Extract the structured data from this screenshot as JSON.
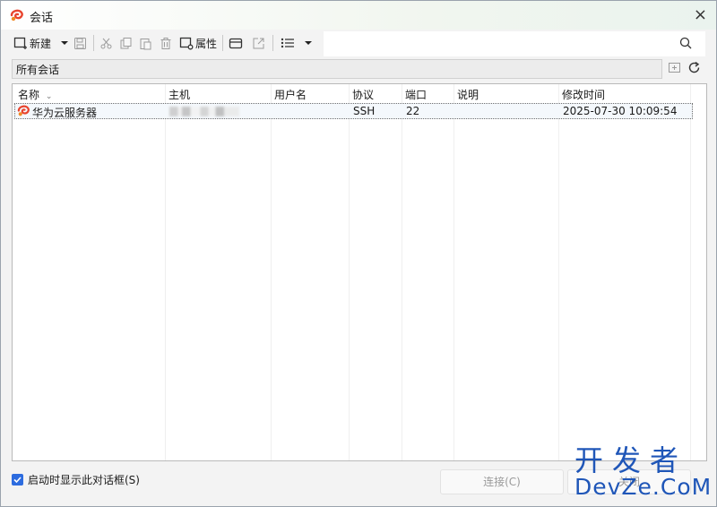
{
  "window": {
    "title": "会话",
    "close_glyph": "×"
  },
  "toolbar": {
    "new_label": "新建",
    "props_label": "属性",
    "icons": [
      "new-session-icon",
      "dropdown-arrow-icon",
      "save-icon",
      "cut-icon",
      "copy-icon",
      "paste-icon",
      "delete-icon",
      "properties-icon",
      "folder-icon",
      "export-icon",
      "list-view-icon",
      "view-dropdown-icon"
    ]
  },
  "search": {
    "value": "",
    "placeholder": ""
  },
  "path": {
    "label": "所有会话"
  },
  "columns": {
    "name": "名称",
    "host": "主机",
    "user": "用户名",
    "protocol": "协议",
    "port": "端口",
    "desc": "说明",
    "modified": "修改时间"
  },
  "sessions": [
    {
      "name": "华为云服务器",
      "host": "",
      "user": "",
      "protocol": "SSH",
      "port": "22",
      "desc": "",
      "modified": "2025-07-30 10:09:54"
    }
  ],
  "footer": {
    "checkbox_label": "启动时显示此对话框(S)",
    "checkbox_checked": true,
    "connect_label": "连接(C)",
    "close_label": "关闭"
  },
  "watermark": {
    "cn": "开发者",
    "en": "DevZe.CoM"
  },
  "colors": {
    "accent": "#2d6cdf",
    "watermark": "#1f56b8",
    "brand": "#e8442e"
  }
}
